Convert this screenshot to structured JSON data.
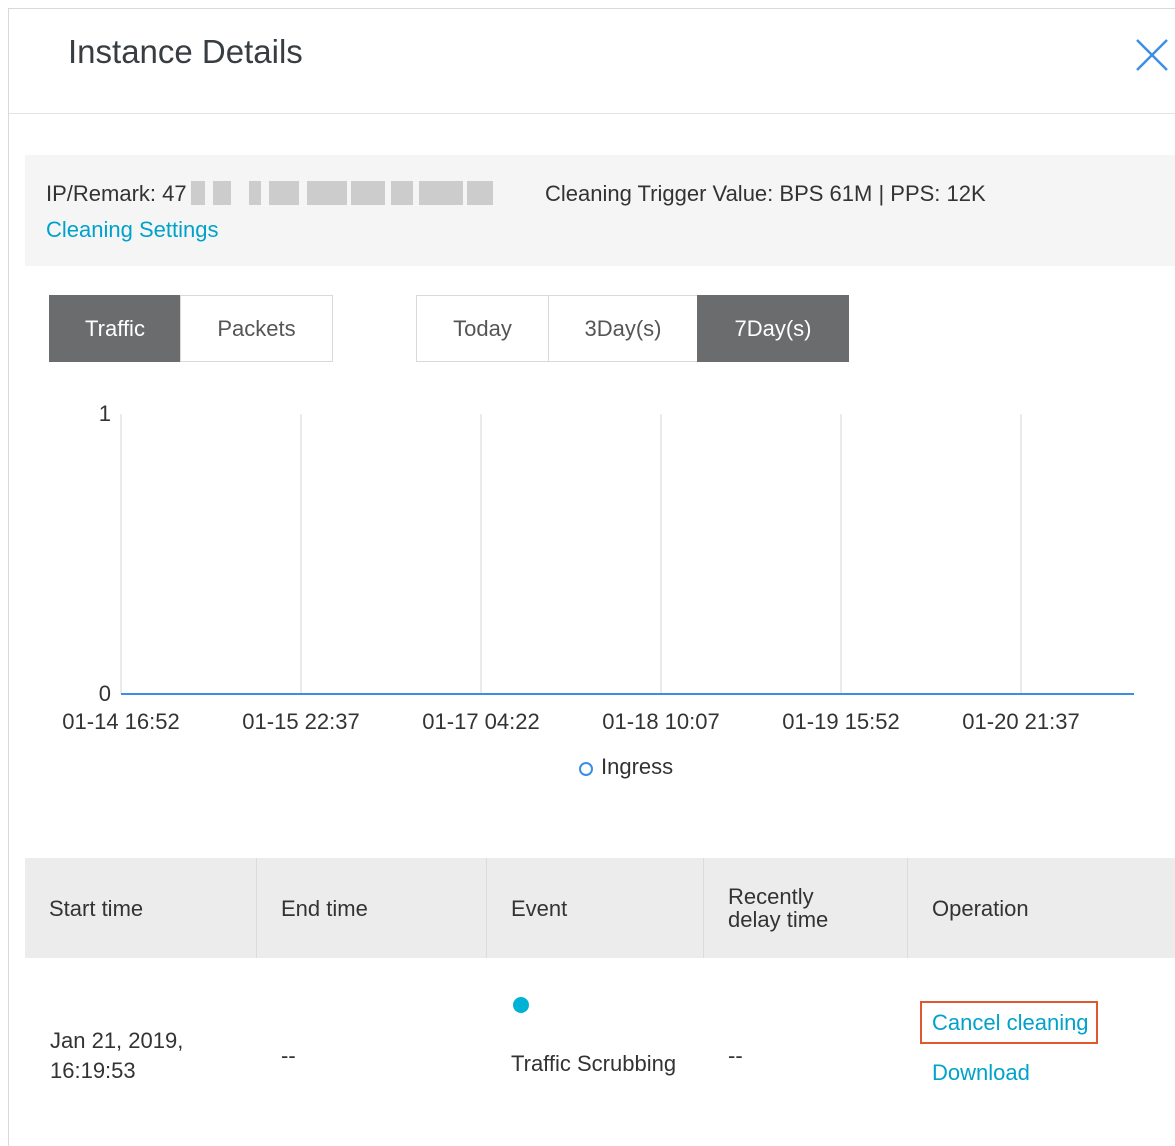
{
  "dialog": {
    "title": "Instance Details",
    "close_icon": "close-icon"
  },
  "info": {
    "ip_label": "IP/Remark: 47",
    "trigger": "Cleaning Trigger Value: BPS 61M | PPS: 12K",
    "settings_link": "Cleaning Settings"
  },
  "metric_tabs": [
    {
      "label": "Traffic",
      "active": true
    },
    {
      "label": "Packets",
      "active": false
    }
  ],
  "range_tabs": [
    {
      "label": "Today",
      "active": false
    },
    {
      "label": "3Day(s)",
      "active": false
    },
    {
      "label": "7Day(s)",
      "active": true
    }
  ],
  "chart_data": {
    "type": "line",
    "x": [
      "01-14 16:52",
      "01-15 22:37",
      "01-17 04:22",
      "01-18 10:07",
      "01-19 15:52",
      "01-20 21:37"
    ],
    "series": [
      {
        "name": "Ingress",
        "values": [
          0,
          0,
          0,
          0,
          0,
          0
        ],
        "color": "#3a8ee6"
      }
    ],
    "ylim": [
      0,
      1
    ],
    "yticks": [
      "0",
      "1"
    ],
    "grid": "vertical",
    "legend": "bottom-center",
    "title": "",
    "xlabel": "",
    "ylabel": ""
  },
  "table": {
    "headers": [
      "Start time",
      "End time",
      "Event",
      "Recently delay time",
      "Operation"
    ],
    "row": {
      "start_time": "Jan 21, 2019, 16:19:53",
      "end_time": "--",
      "event": "Traffic Scrubbing",
      "event_dot_color": "#00b3d4",
      "delay": "--",
      "cancel": "Cancel cleaning",
      "download": "Download"
    }
  }
}
